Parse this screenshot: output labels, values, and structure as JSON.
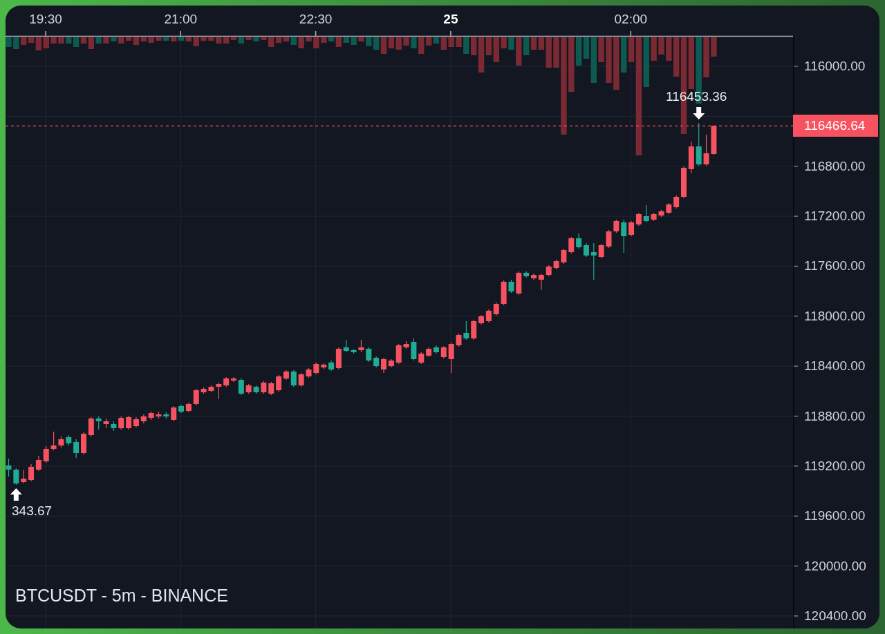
{
  "chart": {
    "time_axis": [
      {
        "label": "19:30",
        "kind": "time"
      },
      {
        "label": "21:00",
        "kind": "time"
      },
      {
        "label": "22:30",
        "kind": "time"
      },
      {
        "label": "25",
        "kind": "day"
      },
      {
        "label": "02:00",
        "kind": "time"
      }
    ],
    "markers": [
      {
        "label": "116453.36",
        "kind": "low"
      },
      {
        "label": "343.67",
        "kind": "high"
      }
    ],
    "price_axis": [
      {
        "label": "116000.00",
        "kind": "tick"
      },
      {
        "label": "116466.64",
        "kind": "last_price"
      },
      {
        "label": "116800.00",
        "kind": "tick"
      },
      {
        "label": "117200.00",
        "kind": "tick"
      },
      {
        "label": "117600.00",
        "kind": "tick"
      },
      {
        "label": "118000.00",
        "kind": "tick"
      },
      {
        "label": "118400.00",
        "kind": "tick"
      },
      {
        "label": "118800.00",
        "kind": "tick"
      },
      {
        "label": "119200.00",
        "kind": "tick"
      },
      {
        "label": "119600.00",
        "kind": "tick"
      },
      {
        "label": "120000.00",
        "kind": "tick"
      },
      {
        "label": "120400.00",
        "kind": "tick"
      }
    ],
    "title": "BTCUSDT - 5m - BINANCE"
  }
}
